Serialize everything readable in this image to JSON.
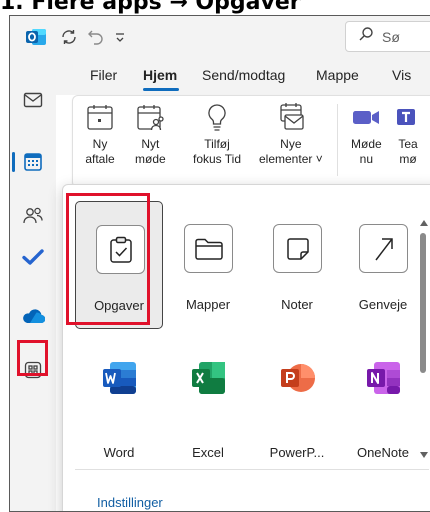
{
  "caption": "1. Flere apps → Opgaver",
  "titlebar": {
    "search_placeholder": "Sø"
  },
  "ribbon": {
    "tabs": [
      "Filer",
      "Hjem",
      "Send/modtag",
      "Mappe",
      "Vis"
    ],
    "active_tab": "Hjem",
    "buttons": [
      {
        "line1": "Ny",
        "line2": "aftale"
      },
      {
        "line1": "Nyt",
        "line2": "møde"
      },
      {
        "line1": "Tilføj",
        "line2": "fokus Tid"
      },
      {
        "line1": "Nye",
        "line2": "elementer ˅"
      },
      {
        "line1": "Møde",
        "line2": "nu"
      },
      {
        "line1": "Tea",
        "line2": "mø"
      }
    ]
  },
  "apps": {
    "tiles": [
      "Opgaver",
      "Mapper",
      "Noter",
      "Genveje",
      "Word",
      "Excel",
      "PowerP...",
      "OneNote"
    ],
    "settings_link": "Indstillinger"
  },
  "colors": {
    "accent": "#0f6cbd",
    "highlight_box": "#e0112b",
    "word": "#185abd",
    "excel": "#107c41",
    "powerpoint": "#c43e1c",
    "onenote": "#7719aa"
  },
  "icons": [
    "outlook-icon",
    "sync-icon",
    "undo-icon",
    "customize-icon",
    "search-icon",
    "mail-icon",
    "calendar-icon",
    "people-icon",
    "todo-icon",
    "onedrive-icon",
    "more-apps-icon"
  ]
}
